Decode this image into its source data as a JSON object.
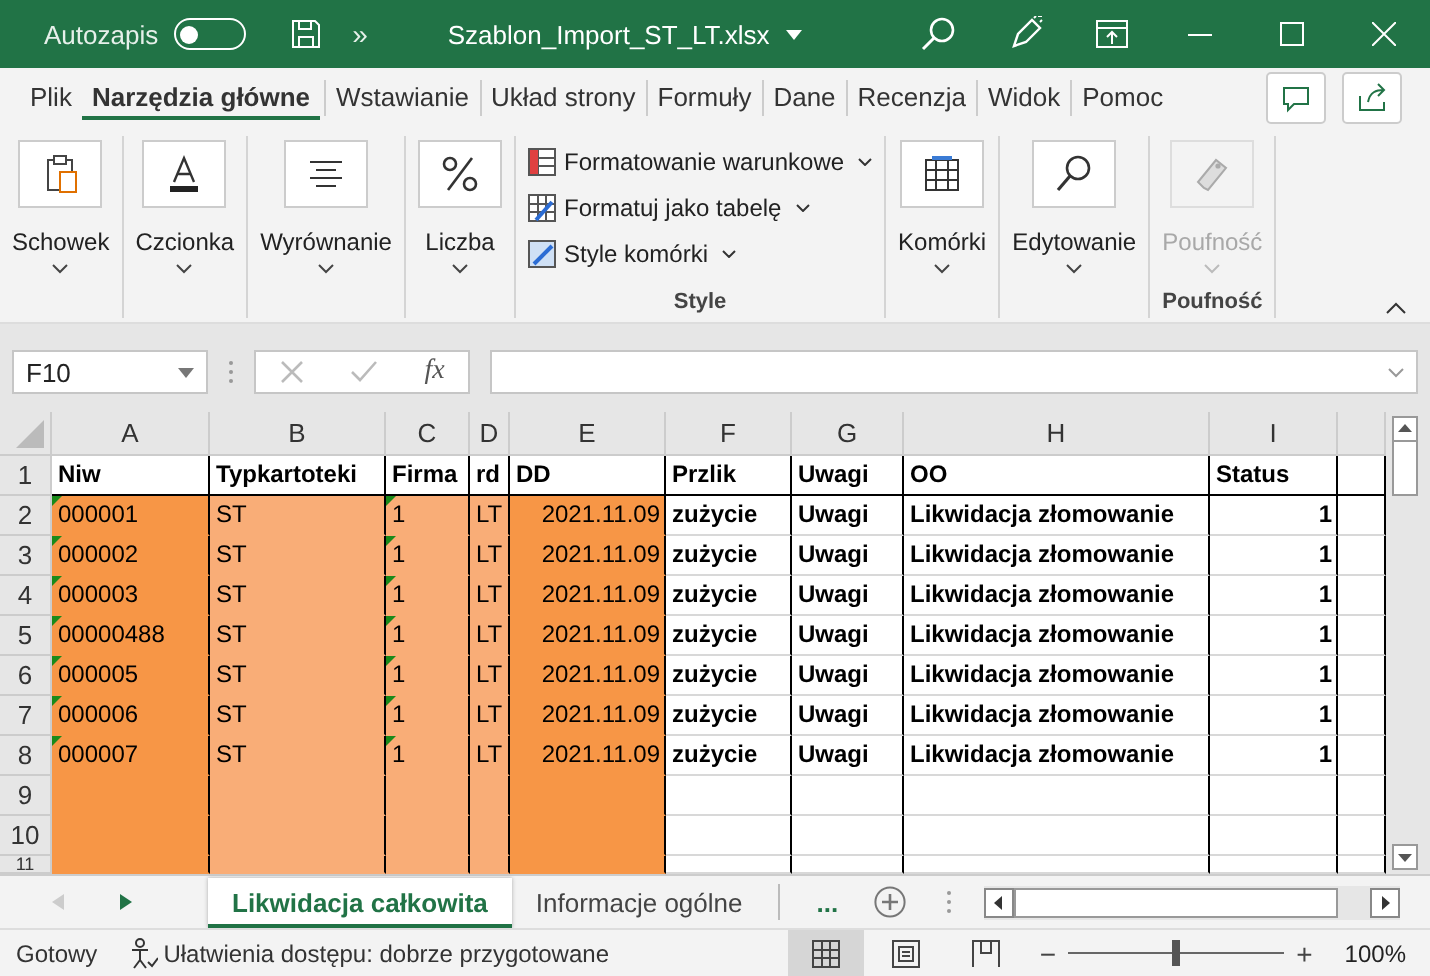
{
  "title_bar": {
    "autosave_label": "Autozapis",
    "autosave_on": false,
    "overflow": "»",
    "title": "Szablon_Import_ST_LT.xlsx"
  },
  "tabs": [
    {
      "label": "Plik",
      "selected": false
    },
    {
      "label": "Narzędzia główne",
      "selected": true
    },
    {
      "label": "Wstawianie",
      "selected": false
    },
    {
      "label": "Układ strony",
      "selected": false
    },
    {
      "label": "Formuły",
      "selected": false
    },
    {
      "label": "Dane",
      "selected": false
    },
    {
      "label": "Recenzja",
      "selected": false
    },
    {
      "label": "Widok",
      "selected": false
    },
    {
      "label": "Pomoc",
      "selected": false
    }
  ],
  "ribbon": {
    "groups": [
      {
        "kind": "large",
        "label": "Schowek",
        "disabled": false
      },
      {
        "kind": "large",
        "label": "Czcionka",
        "disabled": false
      },
      {
        "kind": "large",
        "label": "Wyrównanie",
        "disabled": false
      },
      {
        "kind": "large",
        "label": "Liczba",
        "disabled": false
      },
      {
        "kind": "list",
        "items": [
          "Formatowanie warunkowe",
          "Formatuj jako tabelę",
          "Style komórki"
        ],
        "group_label": "Style"
      },
      {
        "kind": "large",
        "label": "Komórki",
        "disabled": false
      },
      {
        "kind": "large",
        "label": "Edytowanie",
        "disabled": false
      },
      {
        "kind": "large",
        "label": "Poufność",
        "disabled": true,
        "group_label": "Poufność"
      }
    ]
  },
  "formula_bar": {
    "name_box": "F10",
    "function_label": "fx"
  },
  "sheet": {
    "columns": [
      {
        "letter": "A",
        "color": "#f79646",
        "flagged": true,
        "kind": "text",
        "bold": false
      },
      {
        "letter": "B",
        "color": "#f9ad77",
        "flagged": false,
        "kind": "text",
        "bold": false
      },
      {
        "letter": "C",
        "color": "#f9ad77",
        "flagged": true,
        "kind": "text",
        "bold": false
      },
      {
        "letter": "D",
        "color": "#f9ad77",
        "flagged": false,
        "kind": "text",
        "bold": false
      },
      {
        "letter": "E",
        "color": "#f79646",
        "flagged": false,
        "kind": "date",
        "bold": false
      },
      {
        "letter": "F",
        "flagged": false,
        "kind": "text",
        "bold": true
      },
      {
        "letter": "G",
        "flagged": false,
        "kind": "text",
        "bold": true
      },
      {
        "letter": "H",
        "flagged": false,
        "kind": "text",
        "bold": true
      },
      {
        "letter": "I",
        "flagged": false,
        "kind": "number",
        "bold": true
      }
    ],
    "rows": [
      {
        "number": "1",
        "cells": [
          "Niw",
          "Typkartoteki",
          "Firma",
          "rd",
          "DD",
          "Przlik",
          "Uwagi",
          "OO",
          "Status"
        ]
      },
      {
        "number": "2",
        "cells": [
          "000001",
          "ST",
          "1",
          "LT",
          "2021.11.09",
          "zużycie",
          "Uwagi",
          "Likwidacja złomowanie",
          "1"
        ]
      },
      {
        "number": "3",
        "cells": [
          "000002",
          "ST",
          "1",
          "LT",
          "2021.11.09",
          "zużycie",
          "Uwagi",
          "Likwidacja złomowanie",
          "1"
        ]
      },
      {
        "number": "4",
        "cells": [
          "000003",
          "ST",
          "1",
          "LT",
          "2021.11.09",
          "zużycie",
          "Uwagi",
          "Likwidacja złomowanie",
          "1"
        ]
      },
      {
        "number": "5",
        "cells": [
          "00000488",
          "ST",
          "1",
          "LT",
          "2021.11.09",
          "zużycie",
          "Uwagi",
          "Likwidacja złomowanie",
          "1"
        ]
      },
      {
        "number": "6",
        "cells": [
          "000005",
          "ST",
          "1",
          "LT",
          "2021.11.09",
          "zużycie",
          "Uwagi",
          "Likwidacja złomowanie",
          "1"
        ]
      },
      {
        "number": "7",
        "cells": [
          "000006",
          "ST",
          "1",
          "LT",
          "2021.11.09",
          "zużycie",
          "Uwagi",
          "Likwidacja złomowanie",
          "1"
        ]
      },
      {
        "number": "8",
        "cells": [
          "000007",
          "ST",
          "1",
          "LT",
          "2021.11.09",
          "zużycie",
          "Uwagi",
          "Likwidacja złomowanie",
          "1"
        ]
      },
      {
        "number": "9",
        "cells": []
      },
      {
        "number": "10",
        "cells": []
      },
      {
        "number": "11",
        "cells": []
      }
    ]
  },
  "sheet_tabs": {
    "tabs": [
      {
        "label": "Likwidacja całkowita",
        "selected": true
      },
      {
        "label": "Informacje ogólne",
        "selected": false
      }
    ],
    "more": "..."
  },
  "status_bar": {
    "status": "Gotowy",
    "accessibility": "Ułatwienia dostępu: dobrze przygotowane",
    "views": [
      {
        "selected": true
      },
      {
        "selected": false
      },
      {
        "selected": false
      }
    ],
    "zoom": {
      "minus": "−",
      "plus": "+",
      "level": 0.5,
      "reading": "100%"
    }
  }
}
